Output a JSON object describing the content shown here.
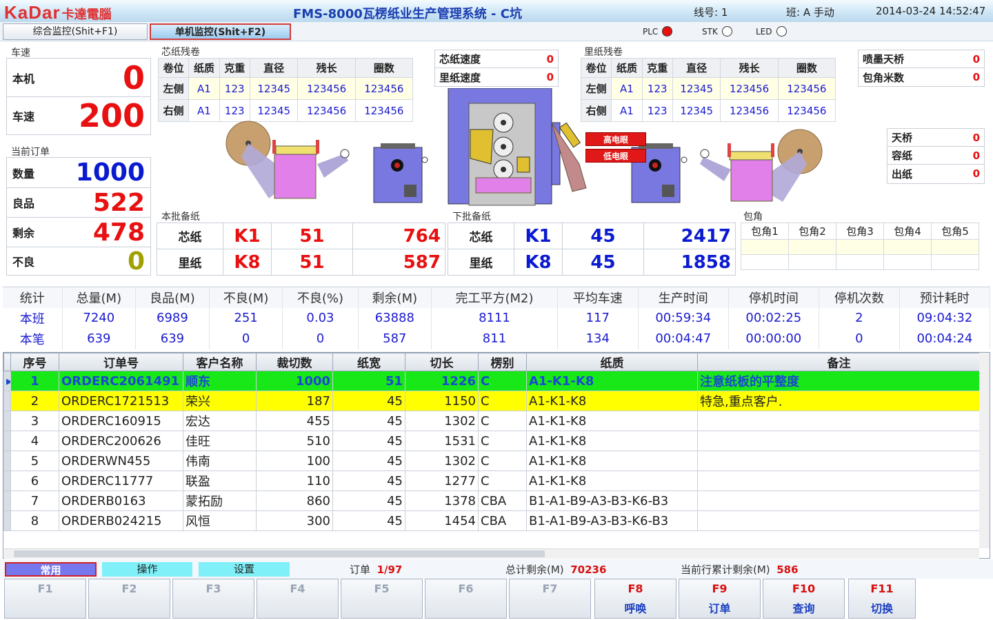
{
  "header": {
    "logo": "KaDar",
    "logo_cn": "卡達電腦",
    "title": "FMS-8000瓦楞纸业生产管理系统 - C坑",
    "line": "线号: 1",
    "shift": "班: A 手动",
    "datetime": "2014-03-24 14:52:47"
  },
  "tabs": [
    {
      "label": "综合监控(Shit+F1)"
    },
    {
      "label": "单机监控(Shit+F2)"
    }
  ],
  "indicators": [
    {
      "label": "PLC",
      "on": true
    },
    {
      "label": "STK",
      "on": false
    },
    {
      "label": "LED",
      "on": false
    }
  ],
  "speed": {
    "title": "车速",
    "machine_label": "本机",
    "machine_value": "0",
    "speed_label": "车速",
    "speed_value": "200"
  },
  "order": {
    "title": "当前订单",
    "qty_label": "数量",
    "qty": "1000",
    "good_label": "良品",
    "good": "522",
    "remain_label": "剩余",
    "remain": "478",
    "bad_label": "不良",
    "bad": "0"
  },
  "core_roll": {
    "title": "芯纸残卷",
    "headers": [
      "卷位",
      "纸质",
      "克重",
      "直径",
      "残长",
      "圈数"
    ],
    "rows": [
      [
        "左侧",
        "A1",
        "123",
        "12345",
        "123456",
        "123456"
      ],
      [
        "右侧",
        "A1",
        "123",
        "12345",
        "123456",
        "123456"
      ]
    ]
  },
  "liner_roll": {
    "title": "里纸残卷",
    "headers": [
      "卷位",
      "纸质",
      "克重",
      "直径",
      "残长",
      "圈数"
    ],
    "rows": [
      [
        "左侧",
        "A1",
        "123",
        "12345",
        "123456",
        "123456"
      ],
      [
        "右侧",
        "A1",
        "123",
        "12345",
        "123456",
        "123456"
      ]
    ]
  },
  "paper_speed": {
    "core_label": "芯纸速度",
    "core": "0",
    "liner_label": "里纸速度",
    "liner": "0"
  },
  "right_counts": {
    "ink_label": "喷墨天桥",
    "ink": "0",
    "corner_label": "包角米数",
    "corner": "0"
  },
  "bridge": {
    "bridge_label": "天桥",
    "bridge": "0",
    "cap_label": "容纸",
    "cap": "0",
    "out_label": "出纸",
    "out": "0"
  },
  "eyes": {
    "high": "高电眼",
    "low": "低电眼"
  },
  "this_batch": {
    "title": "本批备纸",
    "rows": [
      {
        "name": "芯纸",
        "code": "K1",
        "n": "51",
        "len": "764"
      },
      {
        "name": "里纸",
        "code": "K8",
        "n": "51",
        "len": "587"
      }
    ]
  },
  "next_batch": {
    "title": "下批备纸",
    "rows": [
      {
        "name": "芯纸",
        "code": "K1",
        "n": "45",
        "len": "2417"
      },
      {
        "name": "里纸",
        "code": "K8",
        "n": "45",
        "len": "1858"
      }
    ]
  },
  "wrap": {
    "title": "包角",
    "headers": [
      "包角1",
      "包角2",
      "包角3",
      "包角4",
      "包角5"
    ]
  },
  "stats": {
    "headers": [
      "统计",
      "总量(M)",
      "良品(M)",
      "不良(M)",
      "不良(%)",
      "剩余(M)",
      "完工平方(M2)",
      "平均车速",
      "生产时间",
      "停机时间",
      "停机次数",
      "预计耗时"
    ],
    "rows": [
      [
        "本班",
        "7240",
        "6989",
        "251",
        "0.03",
        "63888",
        "8111",
        "117",
        "00:59:34",
        "00:02:25",
        "2",
        "09:04:32"
      ],
      [
        "本笔",
        "639",
        "639",
        "0",
        "0",
        "587",
        "811",
        "134",
        "00:04:47",
        "00:00:00",
        "0",
        "00:04:24"
      ]
    ]
  },
  "orders": {
    "headers": [
      "序号",
      "订单号",
      "客户名称",
      "裁切数",
      "纸宽",
      "切长",
      "楞别",
      "纸质",
      "备注"
    ],
    "rows": [
      [
        "1",
        "ORDERC2061491",
        "顺东",
        "1000",
        "51",
        "1226",
        "C",
        "A1-K1-K8",
        "注意纸板的平整度"
      ],
      [
        "2",
        "ORDERC1721513",
        "荣兴",
        "187",
        "45",
        "1150",
        "C",
        "A1-K1-K8",
        "特急,重点客户."
      ],
      [
        "3",
        "ORDERC160915",
        "宏达",
        "455",
        "45",
        "1302",
        "C",
        "A1-K1-K8",
        ""
      ],
      [
        "4",
        "ORDERC200626",
        "佳旺",
        "510",
        "45",
        "1531",
        "C",
        "A1-K1-K8",
        ""
      ],
      [
        "5",
        "ORDERWN455",
        "伟南",
        "100",
        "45",
        "1302",
        "C",
        "A1-K1-K8",
        ""
      ],
      [
        "6",
        "ORDERC11777",
        "联盈",
        "110",
        "45",
        "1277",
        "C",
        "A1-K1-K8",
        ""
      ],
      [
        "7",
        "ORDERB0163",
        "蒙拓励",
        "860",
        "45",
        "1378",
        "CBA",
        "B1-A1-B9-A3-B3-K6-B3",
        ""
      ],
      [
        "8",
        "ORDERB024215",
        "风恒",
        "300",
        "45",
        "1454",
        "CBA",
        "B1-A1-B9-A3-B3-K6-B3",
        ""
      ]
    ]
  },
  "mode_tabs": [
    "常用",
    "操作",
    "设置"
  ],
  "status": {
    "order_label": "订单",
    "order": "1/97",
    "total_label": "总计剩余(M)",
    "total": "70236",
    "current_label": "当前行累计剩余(M)",
    "current": "586"
  },
  "fkeys": [
    {
      "key": "F1",
      "label": ""
    },
    {
      "key": "F2",
      "label": ""
    },
    {
      "key": "F3",
      "label": ""
    },
    {
      "key": "F4",
      "label": ""
    },
    {
      "key": "F5",
      "label": ""
    },
    {
      "key": "F6",
      "label": ""
    },
    {
      "key": "F7",
      "label": ""
    },
    {
      "key": "F8",
      "label": "呼唤"
    },
    {
      "key": "F9",
      "label": "订单"
    },
    {
      "key": "F10",
      "label": "查询"
    },
    {
      "key": "F11",
      "label": "切换"
    }
  ]
}
